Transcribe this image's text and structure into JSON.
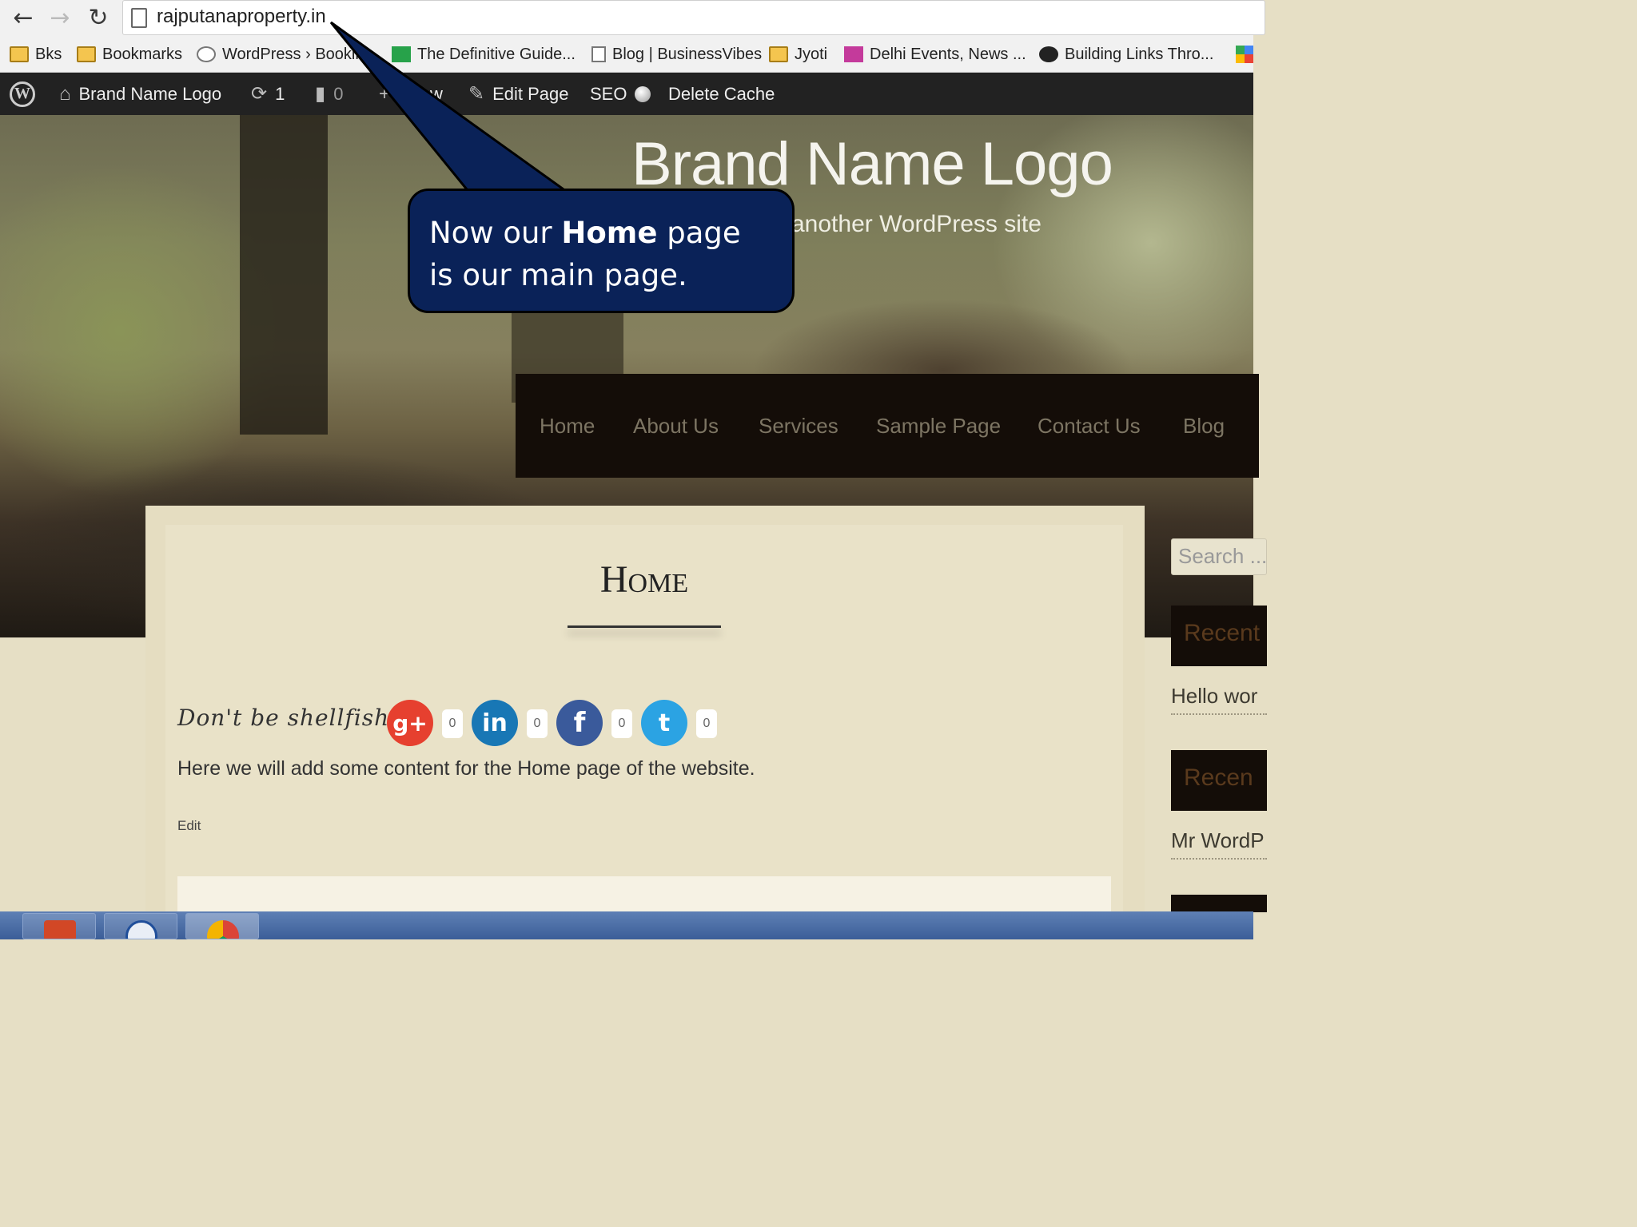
{
  "browser": {
    "url": "rajputanaproperty.in",
    "bookmarks": [
      {
        "label": "Bks",
        "icon": "folder-icon"
      },
      {
        "label": "Bookmarks",
        "icon": "folder-icon"
      },
      {
        "label": "WordPress › Bookin",
        "icon": "wordpress-icon"
      },
      {
        "label": "The Definitive Guide...",
        "icon": "green-site-icon"
      },
      {
        "label": "Blog | BusinessVibes",
        "icon": "page-icon"
      },
      {
        "label": "Jyoti",
        "icon": "folder-icon"
      },
      {
        "label": "Delhi Events, News ...",
        "icon": "magazine-icon"
      },
      {
        "label": "Building Links Thro...",
        "icon": "circle-site-icon"
      }
    ]
  },
  "adminbar": {
    "site_name": "Brand Name Logo",
    "updates_count": "1",
    "comments_count": "0",
    "new_label": "w",
    "edit_label": "Edit Page",
    "seo_label": "SEO",
    "cache_label": "Delete Cache"
  },
  "site": {
    "title": "Brand Name Logo",
    "tagline": "another WordPress site",
    "nav": [
      "Home",
      "About Us",
      "Services",
      "Sample Page",
      "Contact Us",
      "Blog"
    ]
  },
  "page": {
    "title": "Home",
    "share_text": "Don't be shellfish...",
    "social": [
      {
        "name": "google-plus",
        "glyph": "g+",
        "count": "0",
        "color": "#e6402f"
      },
      {
        "name": "linkedin",
        "glyph": "in",
        "count": "0",
        "color": "#1877b5"
      },
      {
        "name": "facebook",
        "glyph": "f",
        "count": "0",
        "color": "#3a5a9b"
      },
      {
        "name": "twitter",
        "glyph": "t",
        "count": "0",
        "color": "#2ba3e3"
      }
    ],
    "body": "Here we will add some content for the Home page of the website.",
    "edit": "Edit"
  },
  "sidebar": {
    "search_placeholder": "Search ...",
    "widgets": [
      {
        "heading": "Recent",
        "link": "Hello wor"
      },
      {
        "heading": "Recen",
        "link": "Mr WordP"
      }
    ]
  },
  "callout": {
    "pre": "Now our ",
    "bold": "Home",
    "post": " page is our main page."
  }
}
